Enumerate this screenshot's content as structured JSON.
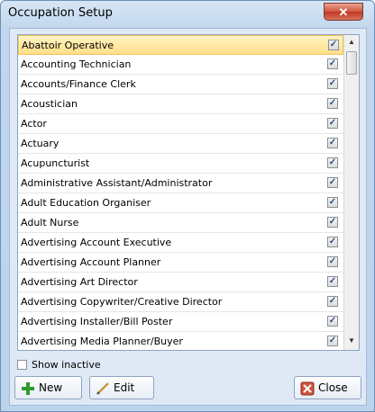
{
  "window": {
    "title": "Occupation Setup",
    "close_glyph": "✕"
  },
  "list": {
    "items": [
      {
        "label": "Abattoir Operative",
        "checked": true,
        "selected": true
      },
      {
        "label": "Accounting Technician",
        "checked": true
      },
      {
        "label": "Accounts/Finance Clerk",
        "checked": true
      },
      {
        "label": "Acoustician",
        "checked": true
      },
      {
        "label": "Actor",
        "checked": true
      },
      {
        "label": "Actuary",
        "checked": true
      },
      {
        "label": "Acupuncturist",
        "checked": true
      },
      {
        "label": "Administrative Assistant/Administrator",
        "checked": true
      },
      {
        "label": "Adult Education Organiser",
        "checked": true
      },
      {
        "label": "Adult Nurse",
        "checked": true
      },
      {
        "label": "Advertising Account Executive",
        "checked": true
      },
      {
        "label": "Advertising Account Planner",
        "checked": true
      },
      {
        "label": "Advertising Art Director",
        "checked": true
      },
      {
        "label": "Advertising Copywriter/Creative Director",
        "checked": true
      },
      {
        "label": "Advertising Installer/Bill Poster",
        "checked": true
      },
      {
        "label": "Advertising Media Planner/Buyer",
        "checked": true
      }
    ],
    "check_glyph": "✓",
    "scroll_up_glyph": "▲",
    "scroll_down_glyph": "▼"
  },
  "show_inactive": {
    "label": "Show inactive",
    "checked": false
  },
  "buttons": {
    "new_label": "New",
    "edit_label": "Edit",
    "close_label": "Close"
  },
  "colors": {
    "selected_row": "#ffe08a",
    "close_accent": "#d0553e",
    "new_icon": "#2e9a2e"
  }
}
